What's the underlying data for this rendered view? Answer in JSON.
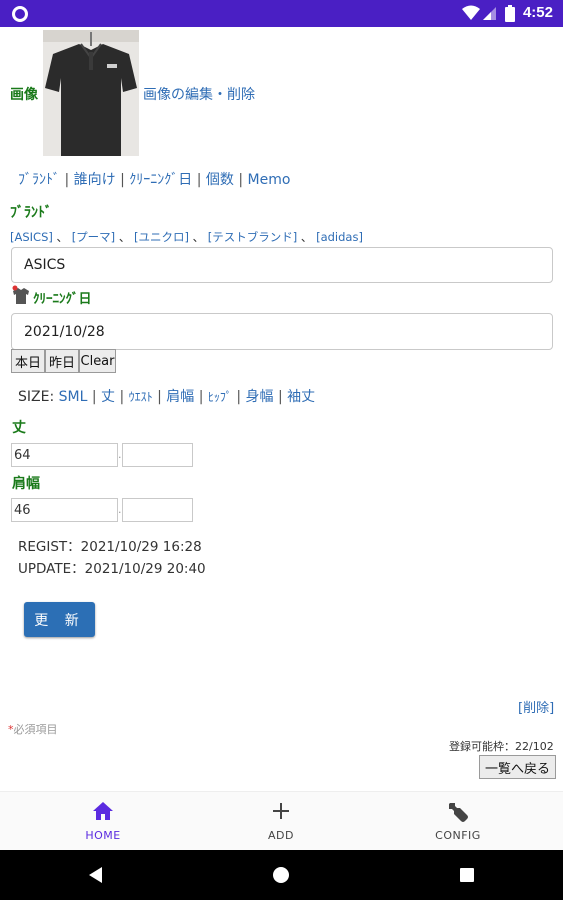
{
  "status_bar": {
    "time": "4:52"
  },
  "image_section": {
    "label": "画像",
    "edit_link": "画像の編集・削除"
  },
  "tabs": [
    {
      "label": "ﾌﾞﾗﾝﾄﾞ"
    },
    {
      "label": "誰向け"
    },
    {
      "label": "ｸﾘｰﾆﾝｸﾞ日"
    },
    {
      "label": "個数"
    },
    {
      "label": "Memo"
    }
  ],
  "brand": {
    "label": "ﾌﾞﾗﾝﾄﾞ",
    "suggestions": [
      "[ASICS]",
      "[プーマ]",
      "[ユニクロ]",
      "[テストブランド]",
      "[adidas]"
    ],
    "value": "ASICS"
  },
  "cleaning": {
    "label": "ｸﾘｰﾆﾝｸﾞ日",
    "value": "2021/10/28",
    "buttons": [
      "本日",
      "昨日",
      "Clear"
    ]
  },
  "size": {
    "prefix": "SIZE:",
    "links": [
      "SML",
      "丈",
      "ｳｴｽﾄ",
      "肩幅",
      "ﾋｯﾌﾟ",
      "身幅",
      "袖丈"
    ]
  },
  "fields": {
    "length_label": "丈",
    "length_value": "64",
    "shoulder_label": "肩幅",
    "shoulder_value": "46",
    "dot": "."
  },
  "meta": {
    "regist": "REGIST：2021/10/29 16:28",
    "update": "UPDATE：2021/10/29 20:40"
  },
  "update_button": "更 新",
  "delete_link": "[削除]",
  "required": {
    "mark": "*",
    "text": "必須項目"
  },
  "capacity": "登録可能枠：22/102",
  "back_button": "一覧へ戻る",
  "bottom_nav": [
    {
      "label": "HOME",
      "icon": "home-icon",
      "active": true
    },
    {
      "label": "ADD",
      "icon": "plus-icon",
      "active": false
    },
    {
      "label": "CONFIG",
      "icon": "wrench-icon",
      "active": false
    }
  ],
  "colors": {
    "accent": "#5b2be0",
    "status_bar": "#4a1fc4",
    "link": "#2f6db5",
    "label_green": "#1a7a1a",
    "button_blue": "#2c6fb5"
  }
}
